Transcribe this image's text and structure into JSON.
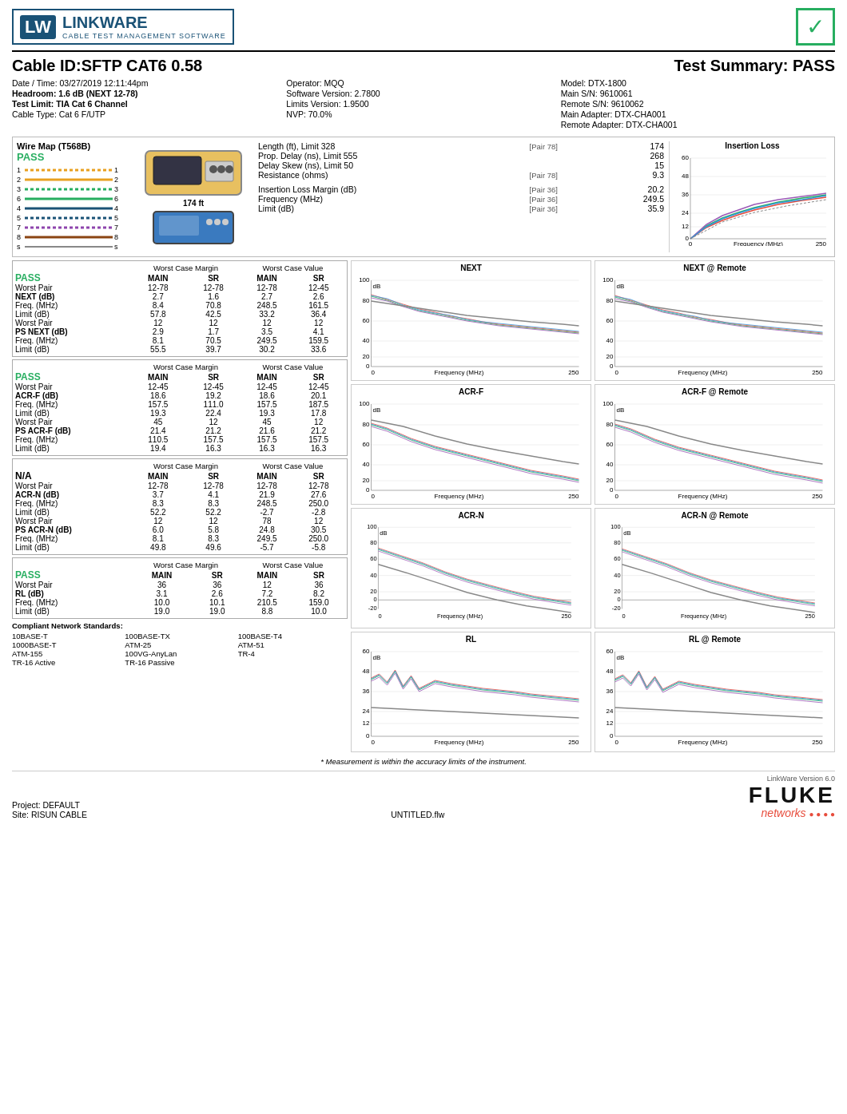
{
  "header": {
    "logo_lw": "LW",
    "logo_name": "LINKWARE",
    "logo_sub": "CABLE TEST MANAGEMENT SOFTWARE",
    "check": "✓",
    "cable_id_label": "Cable ID:SFTP CAT6 0.58",
    "test_summary_label": "Test Summary: PASS"
  },
  "info": {
    "col1": [
      {
        "label": "Date / Time:",
        "value": "03/27/2019 12:11:44pm",
        "bold": false
      },
      {
        "label": "Headroom:",
        "value": "1.6 dB (NEXT 12-78)",
        "bold": true
      },
      {
        "label": "Test Limit:",
        "value": "TIA Cat 6 Channel",
        "bold": true
      },
      {
        "label": "Cable Type:",
        "value": "Cat 6 F/UTP",
        "bold": false
      }
    ],
    "col2": [
      {
        "label": "Operator:",
        "value": "MQQ"
      },
      {
        "label": "Software Version:",
        "value": "2.7800"
      },
      {
        "label": "Limits Version:",
        "value": "1.9500"
      },
      {
        "label": "NVP:",
        "value": "70.0%"
      }
    ],
    "col3": [
      {
        "label": "Model:",
        "value": "DTX-1800"
      },
      {
        "label": "Main S/N:",
        "value": "9610061"
      },
      {
        "label": "Remote S/N:",
        "value": "9610062"
      },
      {
        "label": "Main Adapter:",
        "value": "DTX-CHA001"
      },
      {
        "label": "Remote Adapter:",
        "value": "DTX-CHA001"
      }
    ]
  },
  "wiremap": {
    "title": "Wire Map (T568B)",
    "status": "PASS",
    "distance": "174 ft"
  },
  "measurements": [
    {
      "label": "Length (ft), Limit 328",
      "pair": "[Pair 78]",
      "value": "174"
    },
    {
      "label": "Prop. Delay (ns), Limit 555",
      "pair": "",
      "value": "268"
    },
    {
      "label": "Delay Skew (ns), Limit 50",
      "pair": "",
      "value": "15"
    },
    {
      "label": "Resistance (ohms)",
      "pair": "[Pair 78]",
      "value": "9.3"
    },
    {
      "label": "",
      "pair": "",
      "value": ""
    },
    {
      "label": "Insertion Loss Margin (dB)",
      "pair": "[Pair 36]",
      "value": "20.2"
    },
    {
      "label": "Frequency (MHz)",
      "pair": "[Pair 36]",
      "value": "249.5"
    },
    {
      "label": "Limit (dB)",
      "pair": "[Pair 36]",
      "value": "35.9"
    }
  ],
  "next_table": {
    "status": "PASS",
    "headers": [
      "",
      "Worst Case Margin",
      "",
      "Worst Case Value",
      ""
    ],
    "subheaders": [
      "",
      "MAIN",
      "SR",
      "MAIN",
      "SR"
    ],
    "rows": [
      [
        "Worst Pair",
        "12-78",
        "12-78",
        "12-78",
        "12-45"
      ],
      [
        "NEXT (dB)",
        "2.7",
        "1.6",
        "2.7",
        "2.6"
      ],
      [
        "Freq. (MHz)",
        "8.4",
        "70.8",
        "248.5",
        "161.5"
      ],
      [
        "Limit (dB)",
        "57.8",
        "42.5",
        "33.2",
        "36.4"
      ],
      [
        "Worst Pair",
        "12",
        "12",
        "12",
        "12"
      ],
      [
        "PS NEXT (dB)",
        "2.9",
        "1.7",
        "3.5",
        "4.1"
      ],
      [
        "Freq. (MHz)",
        "8.1",
        "70.5",
        "249.5",
        "159.5"
      ],
      [
        "Limit (dB)",
        "55.5",
        "39.7",
        "30.2",
        "33.6"
      ]
    ]
  },
  "acrf_table": {
    "status": "PASS",
    "headers": [
      "",
      "Worst Case Margin",
      "",
      "Worst Case Value",
      ""
    ],
    "subheaders": [
      "",
      "MAIN",
      "SR",
      "MAIN",
      "SR"
    ],
    "rows": [
      [
        "Worst Pair",
        "12-45",
        "12-45",
        "12-45",
        "12-45"
      ],
      [
        "ACR-F (dB)",
        "18.6",
        "19.2",
        "18.6",
        "20.1"
      ],
      [
        "Freq. (MHz)",
        "157.5",
        "111.0",
        "157.5",
        "187.5"
      ],
      [
        "Limit (dB)",
        "19.3",
        "22.4",
        "19.3",
        "17.8"
      ],
      [
        "Worst Pair",
        "45",
        "12",
        "45",
        "12"
      ],
      [
        "PS ACR-F (dB)",
        "21.4",
        "21.2",
        "21.6",
        "21.2"
      ],
      [
        "Freq. (MHz)",
        "110.5",
        "157.5",
        "157.5",
        "157.5"
      ],
      [
        "Limit (dB)",
        "19.4",
        "16.3",
        "16.3",
        "16.3"
      ]
    ]
  },
  "acrn_table": {
    "status": "N/A",
    "headers": [
      "",
      "Worst Case Margin",
      "",
      "Worst Case Value",
      ""
    ],
    "subheaders": [
      "",
      "MAIN",
      "SR",
      "MAIN",
      "SR"
    ],
    "rows": [
      [
        "Worst Pair",
        "12-78",
        "12-78",
        "12-78",
        "12-78"
      ],
      [
        "ACR-N (dB)",
        "3.7",
        "4.1",
        "21.9",
        "27.6"
      ],
      [
        "Freq. (MHz)",
        "8.3",
        "8.3",
        "248.5",
        "250.0"
      ],
      [
        "Limit (dB)",
        "52.2",
        "52.2",
        "-2.7",
        "-2.8"
      ],
      [
        "Worst Pair",
        "12",
        "12",
        "78",
        "12"
      ],
      [
        "PS ACR-N (dB)",
        "6.0",
        "5.8",
        "24.8",
        "30.5"
      ],
      [
        "Freq. (MHz)",
        "8.1",
        "8.3",
        "249.5",
        "250.0"
      ],
      [
        "Limit (dB)",
        "49.8",
        "49.6",
        "-5.7",
        "-5.8"
      ]
    ]
  },
  "rl_table": {
    "status": "PASS",
    "headers": [
      "",
      "Worst Case Margin",
      "",
      "Worst Case Value",
      ""
    ],
    "subheaders": [
      "",
      "MAIN",
      "SR",
      "MAIN",
      "SR"
    ],
    "rows": [
      [
        "Worst Pair",
        "36",
        "36",
        "12",
        "36"
      ],
      [
        "RL (dB)",
        "3.1",
        "2.6",
        "7.2",
        "8.2"
      ],
      [
        "Freq. (MHz)",
        "10.0",
        "10.1",
        "210.5",
        "159.0"
      ],
      [
        "Limit (dB)",
        "19.0",
        "19.0",
        "8.8",
        "10.0"
      ]
    ]
  },
  "compliance": {
    "title": "Compliant Network Standards:",
    "standards": [
      "10BASE-T",
      "100BASE-TX",
      "100BASE-T4",
      "1000BASE-T",
      "ATM-25",
      "ATM-51",
      "ATM-155",
      "100VG-AnyLan",
      "TR-4",
      "TR-16 Active",
      "TR-16 Passive",
      ""
    ]
  },
  "footnote": "* Measurement is within the accuracy limits of the instrument.",
  "footer": {
    "project": "Project: DEFAULT",
    "site": "Site: RISUN CABLE",
    "filename": "UNTITLED.flw",
    "version": "LinkWare Version 6.0",
    "fluke": "FLUKE",
    "networks": "networks"
  }
}
